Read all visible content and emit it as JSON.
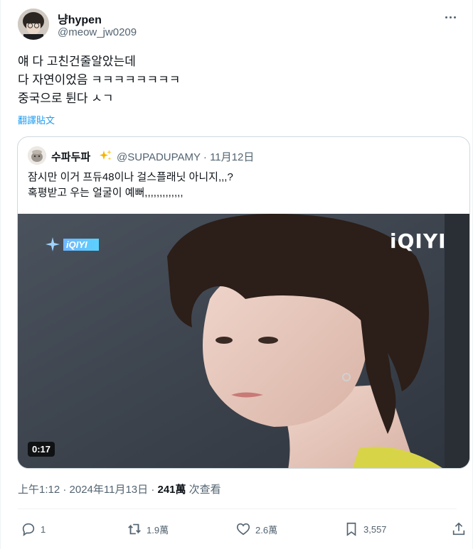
{
  "author": {
    "name": "냥hypen",
    "handle": "@meow_jw0209"
  },
  "tweet": {
    "lines": [
      "얘 다 고친건줄알았는데",
      "다 자연이었음 ㅋㅋㅋㅋㅋㅋㅋㅋ",
      "중국으로 튄다 ㅅㄱ"
    ],
    "translate_label": "翻譯貼文"
  },
  "quote": {
    "name": "수파두파",
    "handle_date": "@SUPADUPAMY · 11月12日",
    "lines": [
      "잠시만 이거 프듀48이나 걸스플래닛 아니지,,,?",
      "혹평받고 우는 얼굴이 예뻐,,,,,,,,,,,,,"
    ],
    "video": {
      "duration": "0:17",
      "watermark_small": "iQIYI",
      "watermark_big": "iQIYI"
    }
  },
  "meta": {
    "time_date": "上午1:12 · 2024年11月13日 · ",
    "views_count": "241萬",
    "views_label": " 次查看"
  },
  "actions": {
    "reply_count": "1",
    "retweet_count": "1.9萬",
    "like_count": "2.6萬",
    "bookmark_count": "3,557"
  },
  "colors": {
    "link": "#1d9bf0",
    "secondary": "#536471",
    "border": "#cfd9de"
  }
}
